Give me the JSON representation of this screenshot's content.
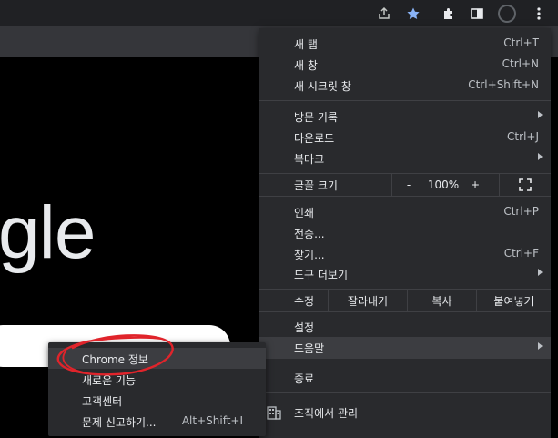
{
  "toolbar": {
    "icons": [
      "share-icon",
      "bookmark-star-icon",
      "extensions-icon",
      "side-panel-icon",
      "profile-avatar",
      "menu-kebab-icon"
    ],
    "accent_star": "#8ab4f8"
  },
  "page": {
    "logo_partial": "gle"
  },
  "main_menu": {
    "items": {
      "new_tab": {
        "label": "새 탭",
        "shortcut": "Ctrl+T"
      },
      "new_window": {
        "label": "새 창",
        "shortcut": "Ctrl+N"
      },
      "incognito": {
        "label": "새 시크릿 창",
        "shortcut": "Ctrl+Shift+N"
      },
      "history": {
        "label": "방문 기록"
      },
      "downloads": {
        "label": "다운로드",
        "shortcut": "Ctrl+J"
      },
      "bookmarks": {
        "label": "북마크"
      },
      "print": {
        "label": "인쇄",
        "shortcut": "Ctrl+P"
      },
      "cast": {
        "label": "전송..."
      },
      "find": {
        "label": "찾기...",
        "shortcut": "Ctrl+F"
      },
      "more_tools": {
        "label": "도구 더보기"
      },
      "settings": {
        "label": "설정"
      },
      "help": {
        "label": "도움말"
      },
      "exit": {
        "label": "종료"
      },
      "managed": {
        "label": "조직에서 관리"
      }
    },
    "zoom": {
      "label": "글꼴 크기",
      "minus": "-",
      "value": "100%",
      "plus": "+"
    },
    "edit": {
      "label": "수정",
      "cut": "잘라내기",
      "copy": "복사",
      "paste": "붙여넣기"
    }
  },
  "help_submenu": {
    "items": {
      "about": {
        "label": "Chrome 정보"
      },
      "whats_new": {
        "label": "새로운 기능"
      },
      "help_center": {
        "label": "고객센터"
      },
      "report": {
        "label": "문제 신고하기...",
        "shortcut": "Alt+Shift+I"
      }
    }
  },
  "colors": {
    "menu_bg": "#292a2d",
    "highlight": "#3c3d41",
    "annotation_red": "#e0242b"
  }
}
